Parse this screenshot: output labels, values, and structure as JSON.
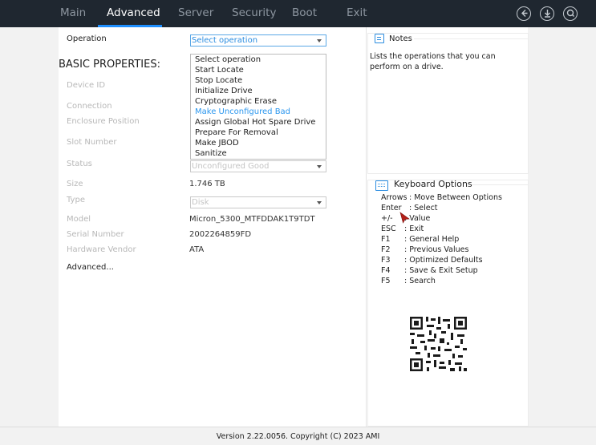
{
  "nav": {
    "tabs": [
      {
        "label": "Main"
      },
      {
        "label": "Advanced"
      },
      {
        "label": "Server"
      },
      {
        "label": "Security"
      },
      {
        "label": "Boot"
      },
      {
        "label": "Exit"
      }
    ],
    "active_tab": "Advanced"
  },
  "top_icons": [
    "back-icon",
    "download-icon",
    "search-icon"
  ],
  "form": {
    "operation_label": "Operation",
    "operation_value": "Select operation",
    "section_title": "BASIC PROPERTIES:",
    "fields": {
      "device_id": {
        "label": "Device ID"
      },
      "connection": {
        "label": "Connection"
      },
      "enclosure_position": {
        "label": "Enclosure Position"
      },
      "slot_number": {
        "label": "Slot Number"
      },
      "status": {
        "label": "Status",
        "value": "Unconfigured Good"
      },
      "size": {
        "label": "Size",
        "value": "1.746 TB"
      },
      "type": {
        "label": "Type",
        "value": "Disk"
      },
      "model": {
        "label": "Model",
        "value": "Micron_5300_MTFDDAK1T9TDT"
      },
      "serial_number": {
        "label": "Serial Number",
        "value": "2002264859FD"
      },
      "hardware_vendor": {
        "label": "Hardware Vendor",
        "value": "ATA"
      }
    },
    "advanced_link": "Advanced..."
  },
  "dropdown": {
    "options": [
      "Select operation",
      "Start Locate",
      "Stop Locate",
      "Initialize Drive",
      "Cryptographic Erase",
      "Make Unconfigured Bad",
      "Assign Global Hot Spare Drive",
      "Prepare For Removal",
      "Make JBOD",
      "Sanitize"
    ],
    "highlighted": "Make Unconfigured Bad"
  },
  "notes": {
    "title": "Notes",
    "text": "Lists the operations that you can perform on a drive."
  },
  "keyboard": {
    "title": "Keyboard Options",
    "rows": [
      {
        "key": "Arrows",
        "desc": ": Move Between Options"
      },
      {
        "key": "Enter",
        "desc": ": Select"
      },
      {
        "key": "+/-",
        "desc": ": Value"
      },
      {
        "key": "ESC",
        "desc": ": Exit"
      },
      {
        "key": "F1",
        "desc": ": General Help"
      },
      {
        "key": "F2",
        "desc": ": Previous Values"
      },
      {
        "key": "F3",
        "desc": ": Optimized Defaults"
      },
      {
        "key": "F4",
        "desc": ": Save & Exit Setup"
      },
      {
        "key": "F5",
        "desc": ": Search"
      }
    ]
  },
  "footer": {
    "version_text": "Version 2.22.0056. Copyright (C) 2023 AMI"
  },
  "colors": {
    "topbar": "#1f2730",
    "accent": "#1e8fff",
    "highlight": "#2a96ee",
    "cursor": "#b4201a"
  }
}
